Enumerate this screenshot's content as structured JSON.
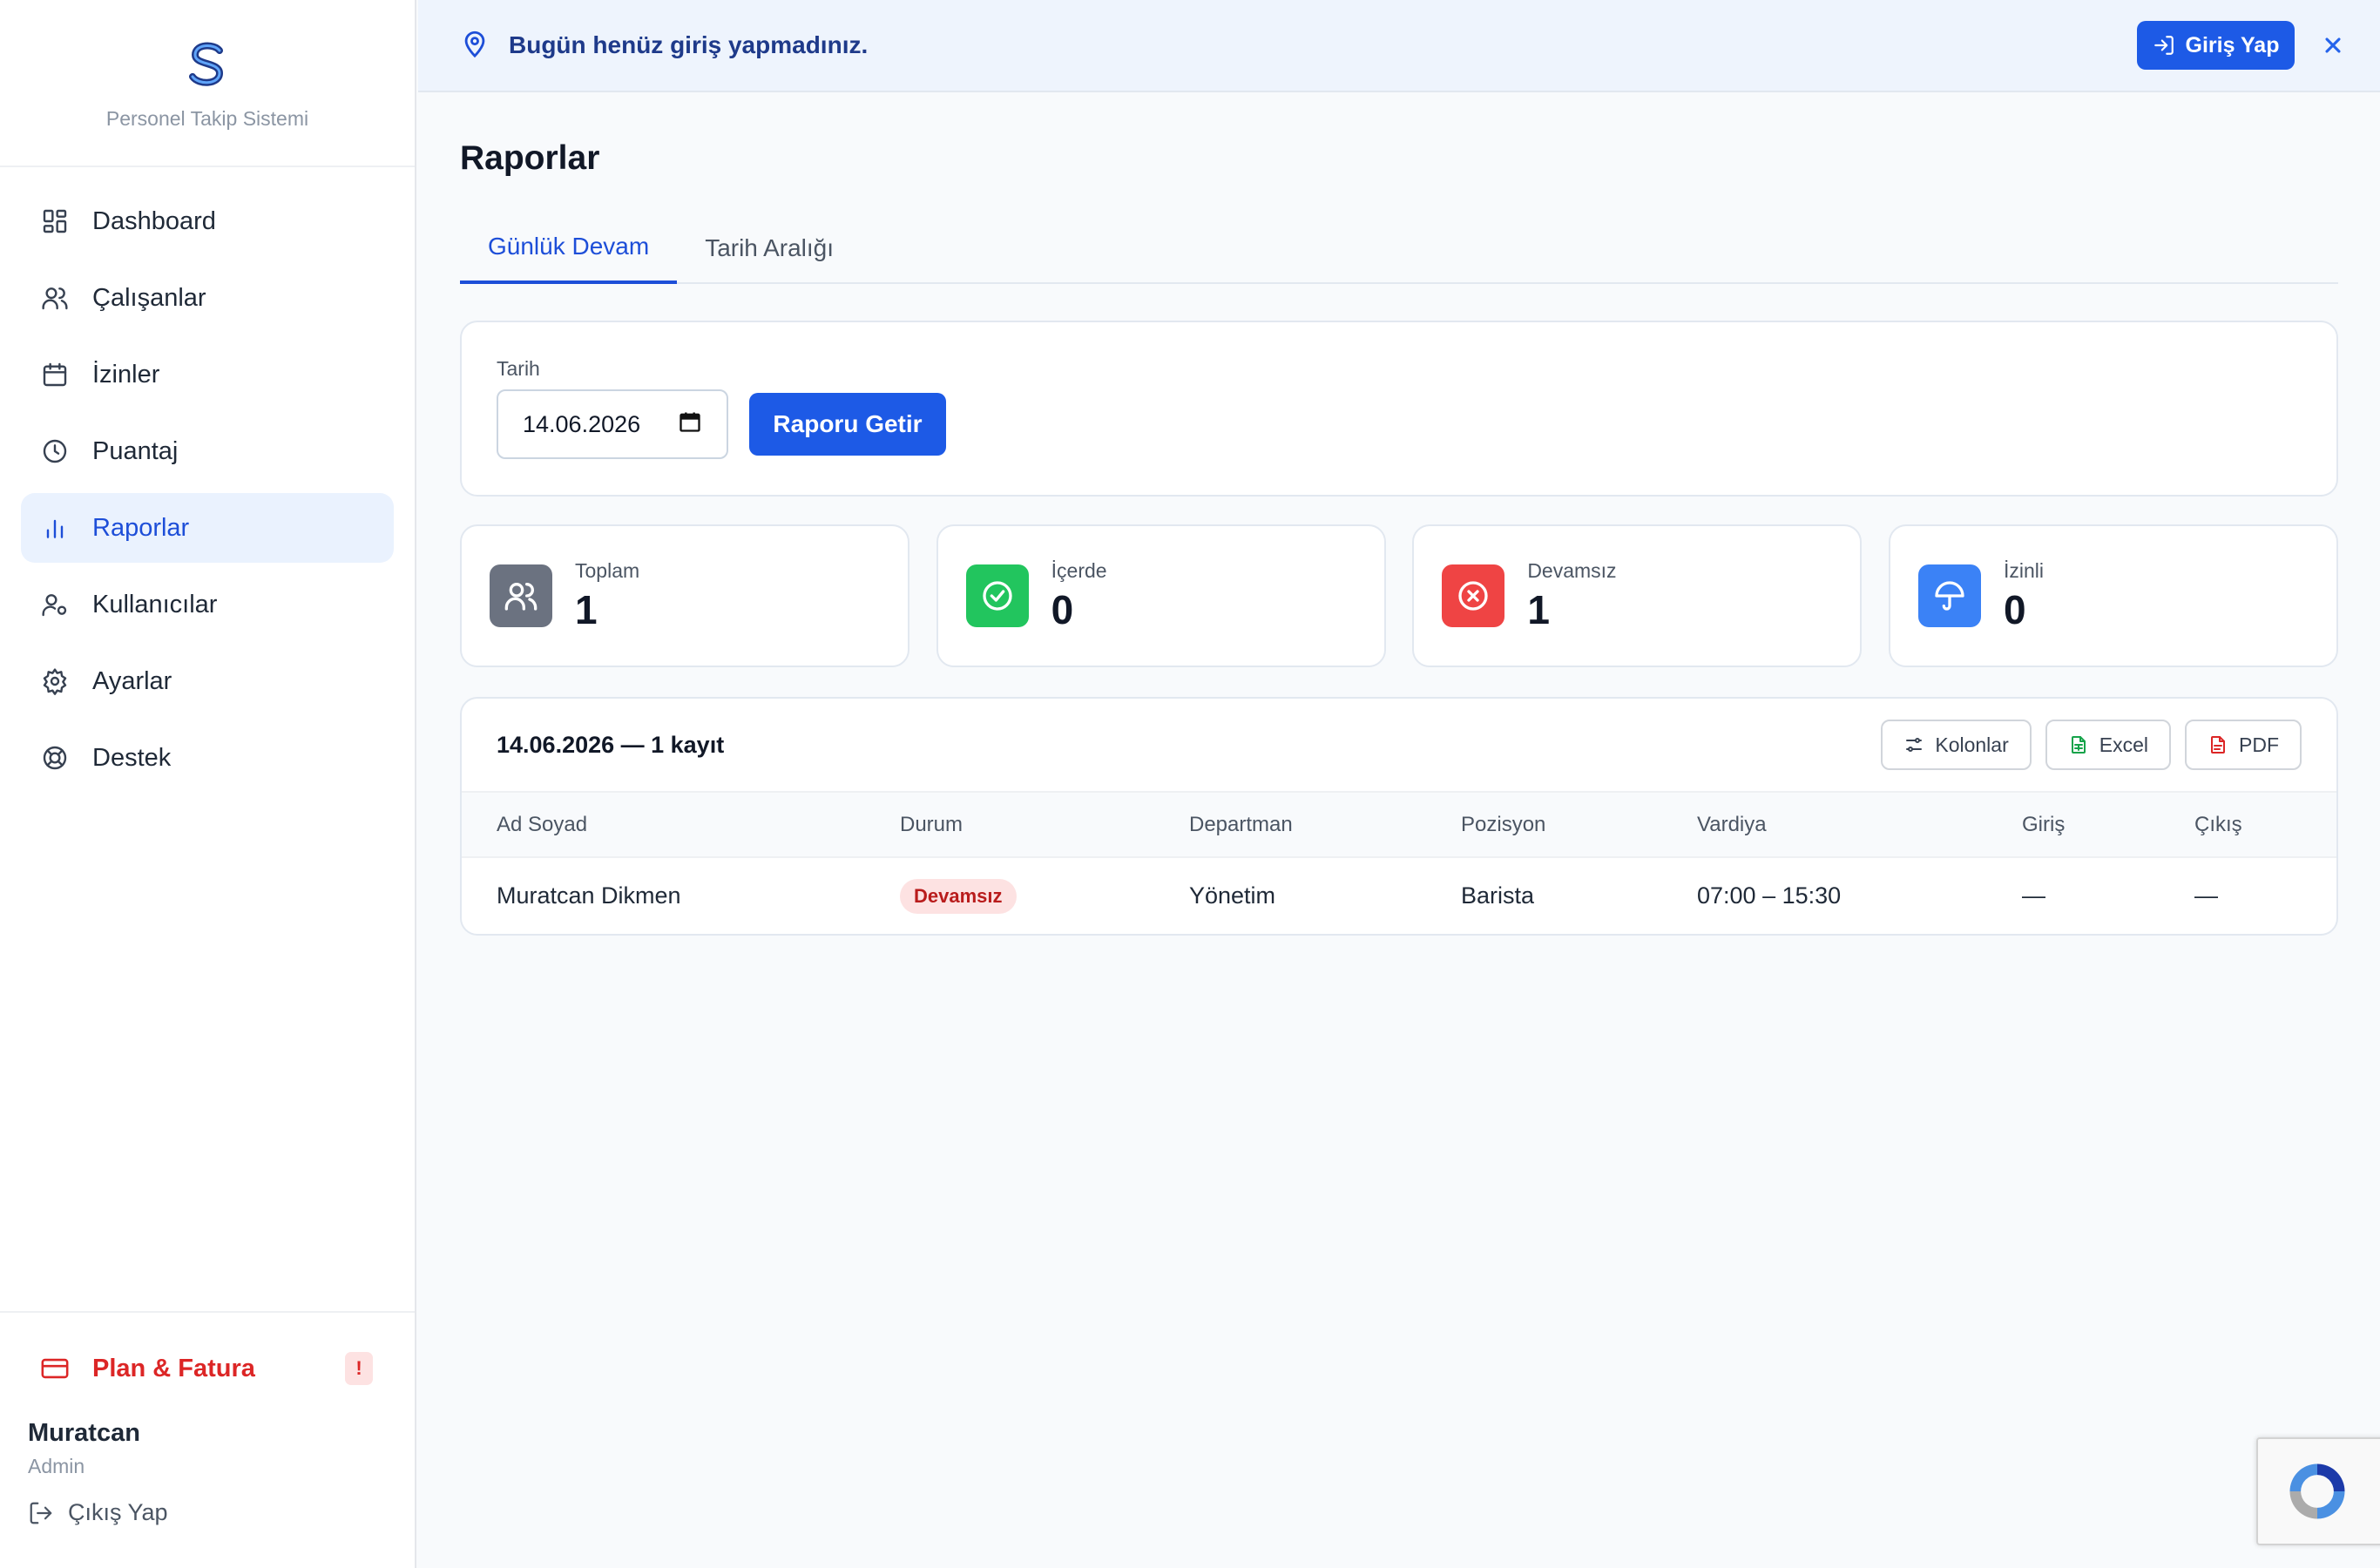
{
  "brand": {
    "name": "Personel Takip Sistemi"
  },
  "sidebar": {
    "items": [
      {
        "label": "Dashboard",
        "icon": "dashboard-icon"
      },
      {
        "label": "Çalışanlar",
        "icon": "users-icon"
      },
      {
        "label": "İzinler",
        "icon": "calendar-icon"
      },
      {
        "label": "Puantaj",
        "icon": "clock-icon"
      },
      {
        "label": "Raporlar",
        "icon": "bar-chart-icon",
        "active": true
      },
      {
        "label": "Kullanıcılar",
        "icon": "user-settings-icon"
      },
      {
        "label": "Ayarlar",
        "icon": "gear-icon"
      },
      {
        "label": "Destek",
        "icon": "lifebuoy-icon"
      }
    ],
    "plan": {
      "label": "Plan & Fatura",
      "badge": "!"
    },
    "user": {
      "name": "Muratcan",
      "role": "Admin"
    },
    "logout_label": "Çıkış Yap"
  },
  "banner": {
    "message": "Bugün henüz giriş yapmadınız.",
    "login_label": "Giriş Yap"
  },
  "page": {
    "title": "Raporlar",
    "tabs": [
      {
        "label": "Günlük Devam",
        "active": true
      },
      {
        "label": "Tarih Aralığı",
        "active": false
      }
    ]
  },
  "filter": {
    "date_label": "Tarih",
    "date_value": "14.06.2026",
    "fetch_label": "Raporu Getir"
  },
  "stats": [
    {
      "label": "Toplam",
      "value": "1",
      "color": "#6b7280",
      "icon": "users-icon"
    },
    {
      "label": "İçerde",
      "value": "0",
      "color": "#22c55e",
      "icon": "check-circle-icon"
    },
    {
      "label": "Devamsız",
      "value": "1",
      "color": "#ef4444",
      "icon": "x-circle-icon"
    },
    {
      "label": "İzinli",
      "value": "0",
      "color": "#3b82f6",
      "icon": "umbrella-icon"
    }
  ],
  "report": {
    "title": "14.06.2026 — 1 kayıt",
    "tools": {
      "columns": "Kolonlar",
      "excel": "Excel",
      "pdf": "PDF"
    },
    "headers": [
      "Ad Soyad",
      "Durum",
      "Departman",
      "Pozisyon",
      "Vardiya",
      "Giriş",
      "Çıkış"
    ],
    "rows": [
      {
        "name": "Muratcan Dikmen",
        "status": "Devamsız",
        "department": "Yönetim",
        "position": "Barista",
        "shift": "07:00 – 15:30",
        "checkin": "—",
        "checkout": "—"
      }
    ]
  },
  "colors": {
    "accent": "#1d5ae6",
    "danger": "#dc2626",
    "success": "#22c55e",
    "info": "#3b82f6"
  }
}
